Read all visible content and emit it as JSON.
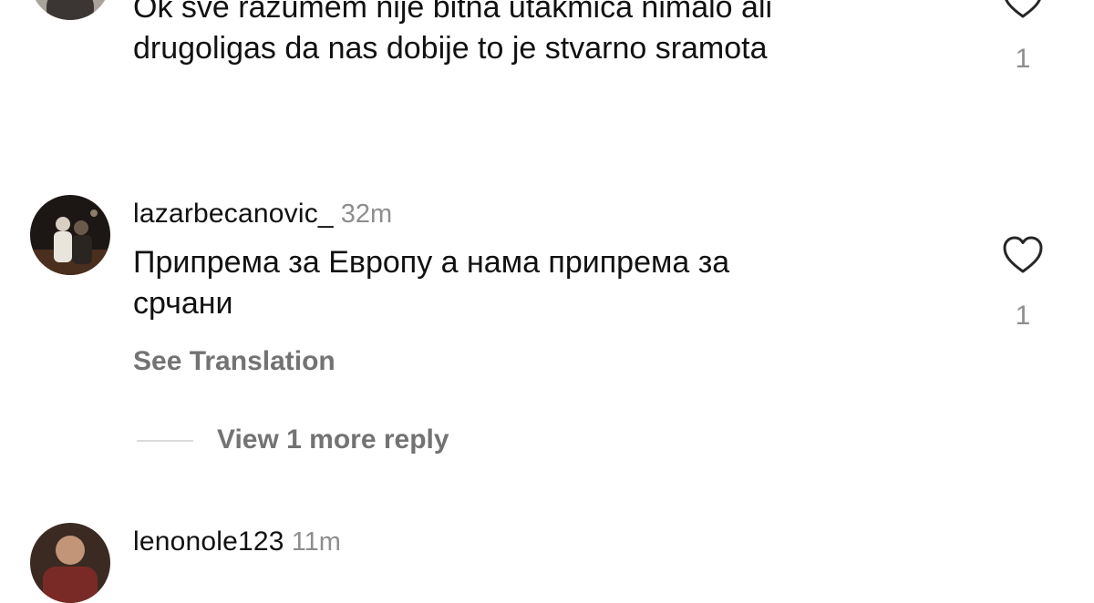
{
  "comments": [
    {
      "text_lines": [
        "Ok sve razumem nije bitna utakmica nimalo ali",
        "drugoligas da nas dobije to je stvarno sramota"
      ],
      "likes": "1"
    },
    {
      "username": "lazarbecanovic_",
      "time": "32m",
      "text_lines": [
        "Припрема за Европу а нама припрема за",
        "срчани"
      ],
      "likes": "1",
      "see_translation": "See Translation",
      "view_replies": "View 1 more reply"
    },
    {
      "username": "lenonole123",
      "time": "11m"
    }
  ],
  "icons": {
    "like": "heart-outline-icon"
  },
  "colors": {
    "text": "#111111",
    "secondary": "#8e8e8e",
    "action": "#737373",
    "divider": "#dbdbdb"
  }
}
